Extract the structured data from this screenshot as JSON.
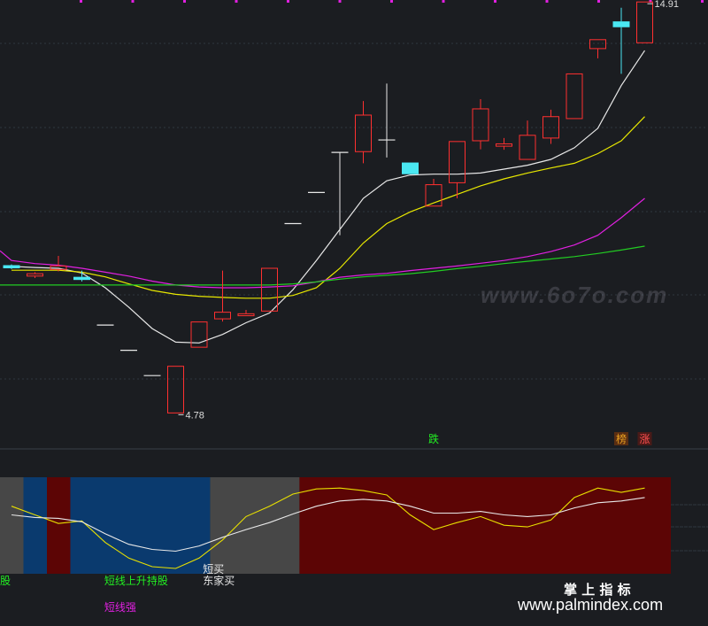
{
  "chart_data": [
    {
      "type": "candlestick",
      "title": "",
      "grid": true,
      "price_range": [
        3.9,
        15.4
      ],
      "candles": [
        {
          "open": 8.5,
          "close": 8.58,
          "high": 8.6,
          "low": 8.48,
          "dir": "down"
        },
        {
          "open": 8.3,
          "close": 8.36,
          "high": 8.4,
          "low": 8.25,
          "dir": "up"
        },
        {
          "open": 8.47,
          "close": 8.56,
          "high": 8.82,
          "low": 8.42,
          "dir": "up"
        },
        {
          "open": 8.2,
          "close": 8.28,
          "high": 8.44,
          "low": 8.16,
          "dir": "down"
        },
        {
          "open": 7.04,
          "close": 7.04,
          "high": 7.04,
          "low": 7.04,
          "dir": "flat"
        },
        {
          "open": 6.39,
          "close": 6.39,
          "high": 6.39,
          "low": 6.39,
          "dir": "flat"
        },
        {
          "open": 5.74,
          "close": 5.74,
          "high": 5.74,
          "low": 5.74,
          "dir": "flat"
        },
        {
          "open": 4.78,
          "close": 5.98,
          "high": 5.98,
          "low": 4.78,
          "dir": "up"
        },
        {
          "open": 6.47,
          "close": 7.12,
          "high": 7.12,
          "low": 6.47,
          "dir": "up"
        },
        {
          "open": 7.2,
          "close": 7.37,
          "high": 8.44,
          "low": 7.13,
          "dir": "up"
        },
        {
          "open": 7.28,
          "close": 7.33,
          "high": 7.43,
          "low": 7.28,
          "dir": "up"
        },
        {
          "open": 7.4,
          "close": 8.5,
          "high": 8.5,
          "low": 7.4,
          "dir": "up"
        },
        {
          "open": 9.65,
          "close": 9.65,
          "high": 9.65,
          "low": 9.65,
          "dir": "flat"
        },
        {
          "open": 10.45,
          "close": 10.45,
          "high": 10.45,
          "low": 10.45,
          "dir": "flat"
        },
        {
          "open": 11.48,
          "close": 11.48,
          "high": 11.48,
          "low": 9.35,
          "dir": "flat"
        },
        {
          "open": 11.5,
          "close": 12.44,
          "high": 12.8,
          "low": 11.2,
          "dir": "up"
        },
        {
          "open": 11.8,
          "close": 11.8,
          "high": 13.25,
          "low": 11.35,
          "dir": "flat"
        },
        {
          "open": 11.22,
          "close": 10.92,
          "high": 11.22,
          "low": 10.92,
          "dir": "down"
        },
        {
          "open": 10.1,
          "close": 10.65,
          "high": 10.8,
          "low": 10.1,
          "dir": "up"
        },
        {
          "open": 10.7,
          "close": 11.76,
          "high": 11.76,
          "low": 10.3,
          "dir": "up"
        },
        {
          "open": 11.78,
          "close": 12.6,
          "high": 12.85,
          "low": 11.56,
          "dir": "up"
        },
        {
          "open": 11.64,
          "close": 11.7,
          "high": 11.85,
          "low": 11.55,
          "dir": "up"
        },
        {
          "open": 11.3,
          "close": 11.92,
          "high": 12.3,
          "low": 11.3,
          "dir": "up"
        },
        {
          "open": 11.85,
          "close": 12.4,
          "high": 12.58,
          "low": 11.7,
          "dir": "up"
        },
        {
          "open": 12.35,
          "close": 13.5,
          "high": 13.5,
          "low": 12.35,
          "dir": "up"
        },
        {
          "open": 14.15,
          "close": 14.38,
          "high": 14.38,
          "low": 13.9,
          "dir": "up"
        },
        {
          "open": 14.7,
          "close": 14.85,
          "high": 15.2,
          "low": 13.5,
          "dir": "down"
        },
        {
          "open": 14.3,
          "close": 15.35,
          "high": 15.35,
          "low": 14.3,
          "dir": "up"
        }
      ],
      "ma_lines": [
        {
          "color": "#e8e8e8",
          "values": [
            8.55,
            8.52,
            8.5,
            8.38,
            8.0,
            7.5,
            6.95,
            6.6,
            6.58,
            6.8,
            7.1,
            7.35,
            7.95,
            8.7,
            9.5,
            10.3,
            10.75,
            10.9,
            10.92,
            10.92,
            10.95,
            11.05,
            11.15,
            11.3,
            11.6,
            12.1,
            13.2,
            14.1
          ]
        },
        {
          "color": "#e8e800",
          "values": [
            8.45,
            8.45,
            8.45,
            8.4,
            8.28,
            8.1,
            7.93,
            7.83,
            7.78,
            7.75,
            7.73,
            7.73,
            7.8,
            8.0,
            8.5,
            9.15,
            9.65,
            9.95,
            10.18,
            10.4,
            10.62,
            10.8,
            10.95,
            11.08,
            11.2,
            11.45,
            11.78,
            12.4
          ]
        },
        {
          "color": "#e020e0",
          "values": [
            8.7,
            8.62,
            8.58,
            8.5,
            8.4,
            8.3,
            8.17,
            8.07,
            8.02,
            8.0,
            8.0,
            8.02,
            8.05,
            8.15,
            8.27,
            8.33,
            8.37,
            8.44,
            8.5,
            8.56,
            8.63,
            8.7,
            8.8,
            8.93,
            9.1,
            9.35,
            9.8,
            10.3
          ]
        },
        {
          "color": "#22cc22",
          "values": [
            8.07,
            8.07,
            8.07,
            8.07,
            8.07,
            8.07,
            8.07,
            8.07,
            8.07,
            8.07,
            8.07,
            8.07,
            8.1,
            8.15,
            8.22,
            8.28,
            8.32,
            8.36,
            8.42,
            8.49,
            8.55,
            8.62,
            8.68,
            8.74,
            8.8,
            8.88,
            8.97,
            9.07
          ]
        }
      ],
      "annotations": [
        {
          "text": "14.91",
          "candle": 27,
          "price": 15.35
        },
        {
          "text": "4.78",
          "candle": 7,
          "price": 4.78
        }
      ],
      "markers": [
        {
          "text": "跌",
          "candle": 18,
          "color": "#22ee22"
        },
        {
          "text": "榜",
          "candle": 26,
          "color": "#e8a020",
          "bg": "#5a2e12"
        },
        {
          "text": "涨",
          "candle": 27,
          "color": "#ff5050",
          "bg": "#4a1a18"
        }
      ]
    },
    {
      "type": "indicator",
      "grid": true,
      "y_range": [
        0,
        1
      ],
      "bands": [
        {
          "from": 0,
          "to": 1,
          "color": "#474747"
        },
        {
          "from": 1,
          "to": 2,
          "color": "#0a3a6e"
        },
        {
          "from": 2,
          "to": 3,
          "color": "#5c0505"
        },
        {
          "from": 3,
          "to": 8.96,
          "color": "#0a3a6e"
        },
        {
          "from": 8.96,
          "to": 12.77,
          "color": "#474747"
        },
        {
          "from": 12.77,
          "to": 28.65,
          "color": "#5c0505"
        }
      ],
      "yellow_line": [
        0.72,
        0.62,
        0.52,
        0.55,
        0.3,
        0.12,
        0.02,
        0,
        0.12,
        0.33,
        0.6,
        0.72,
        0.86,
        0.92,
        0.93,
        0.9,
        0.85,
        0.62,
        0.45,
        0.53,
        0.6,
        0.5,
        0.48,
        0.56,
        0.82,
        0.93,
        0.88,
        0.93
      ],
      "white_line": [
        0.62,
        0.59,
        0.58,
        0.54,
        0.4,
        0.28,
        0.22,
        0.2,
        0.26,
        0.36,
        0.45,
        0.53,
        0.63,
        0.72,
        0.78,
        0.8,
        0.78,
        0.72,
        0.64,
        0.64,
        0.66,
        0.62,
        0.6,
        0.62,
        0.7,
        0.76,
        0.78,
        0.82
      ],
      "labels": [
        {
          "text": "股",
          "color": "#22ee22",
          "at": 0,
          "row": 0
        },
        {
          "text": "短线上升持股",
          "color": "#22ee22",
          "at": 4.45,
          "row": 0
        },
        {
          "text": "短线强",
          "color": "#e020e0",
          "at": 4.45,
          "row": 1
        },
        {
          "text": "短买",
          "color": "#e8e8e8",
          "at": 8.65,
          "row": -1
        },
        {
          "text": "东家买",
          "color": "#e8e8e8",
          "at": 8.65,
          "row": 0
        }
      ]
    }
  ],
  "watermarks": {
    "mid": "www.6o7o.com",
    "footer_title": "掌 上 指 标",
    "footer_url": "www.palmindex.com"
  },
  "colors": {
    "up": "#ff3030",
    "down": "#4ae8f2",
    "flat": "#e8e8e8",
    "grid": "#2f3640",
    "top_dots": "#e020e0"
  }
}
